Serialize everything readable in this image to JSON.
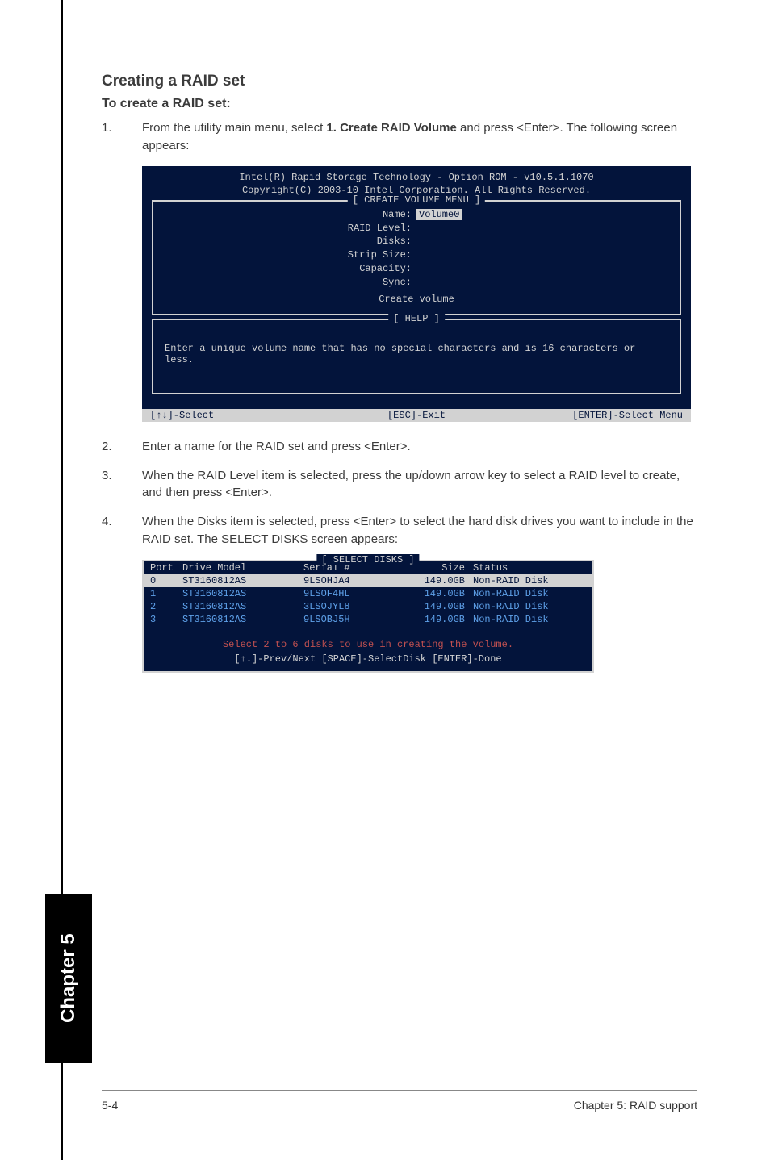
{
  "headings": {
    "title": "Creating a RAID set",
    "subtitle": "To create a RAID set:"
  },
  "steps": {
    "s1": {
      "num": "1.",
      "pre": "From the utility main menu, select ",
      "bold": "1. Create RAID Volume",
      "post": " and press <Enter>. The following screen appears:"
    },
    "s2": {
      "num": "2.",
      "text": "Enter a name for the RAID set and press <Enter>."
    },
    "s3": {
      "num": "3.",
      "text": "When the RAID Level item is selected, press the up/down arrow key to select a RAID level to create, and then press <Enter>."
    },
    "s4": {
      "num": "4.",
      "text": "When the Disks item is selected, press <Enter> to select the hard disk drives you want to include in the RAID set. The SELECT DISKS screen appears:"
    }
  },
  "bios": {
    "line1": "Intel(R) Rapid Storage Technology - Option ROM - v10.5.1.1070",
    "line2": "Copyright(C) 2003-10 Intel Corporation.  All Rights Reserved.",
    "create_legend": "[ CREATE VOLUME MENU ]",
    "labels": {
      "name": "Name:",
      "name_val": "Volume0",
      "raid": "RAID Level:",
      "disks": "Disks:",
      "strip": "Strip Size:",
      "capacity": "Capacity:",
      "sync": "Sync:",
      "create": "Create volume"
    },
    "help_legend": "[ HELP ]",
    "help_text": "Enter a unique volume name that has no special characters and is 16 characters or less.",
    "bottom": {
      "select": "[↑↓]-Select",
      "esc": "[ESC]-Exit",
      "enter": "[ENTER]-Select Menu"
    }
  },
  "disks": {
    "legend": "[ SELECT DISKS ]",
    "hdr": {
      "port": "Port",
      "model": "Drive Model",
      "serial": "Serial #",
      "size": "Size",
      "status": "Status"
    },
    "rows": [
      {
        "port": "0",
        "model": "ST3160812AS",
        "serial": "9LSOHJA4",
        "size": "149.0GB",
        "status": "Non-RAID Disk"
      },
      {
        "port": "1",
        "model": "ST3160812AS",
        "serial": "9LSOF4HL",
        "size": "149.0GB",
        "status": "Non-RAID Disk"
      },
      {
        "port": "2",
        "model": "ST3160812AS",
        "serial": "3LSOJYL8",
        "size": "149.0GB",
        "status": "Non-RAID Disk"
      },
      {
        "port": "3",
        "model": "ST3160812AS",
        "serial": "9LSOBJ5H",
        "size": "149.0GB",
        "status": "Non-RAID Disk"
      }
    ],
    "msg": "Select 2 to 6 disks to use in creating the volume.",
    "nav": "[↑↓]-Prev/Next [SPACE]-SelectDisk [ENTER]-Done"
  },
  "tab": "Chapter 5",
  "footer": {
    "left": "5-4",
    "right": "Chapter 5: RAID support"
  }
}
